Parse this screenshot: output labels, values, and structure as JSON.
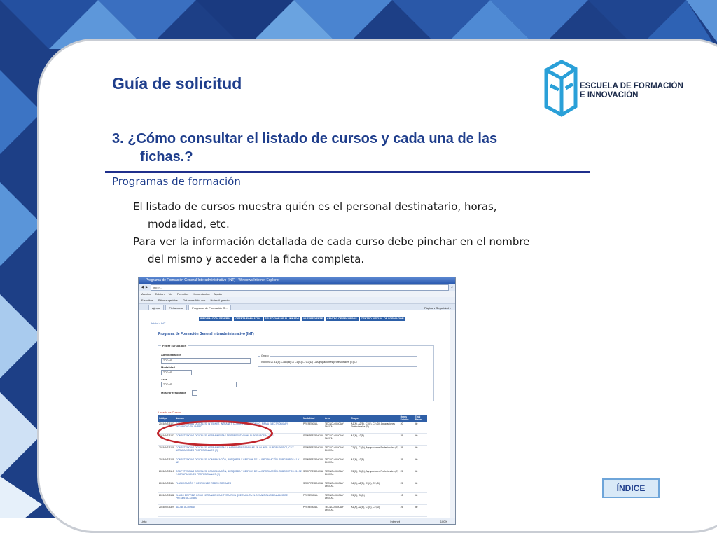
{
  "slide": {
    "title": "Guía de solicitud",
    "logo": {
      "line1": "ESCUELA DE FORMACIÓN",
      "line2": "E INNOVACIÓN"
    },
    "heading": {
      "line1": "3. ¿Cómo consultar el listado de cursos y cada una de las",
      "line2": "fichas.?"
    },
    "subheading": "Programas de formación",
    "paragraph1": {
      "line1": "El listado de cursos muestra quién es el personal destinatario, horas,",
      "line2": "modalidad, etc."
    },
    "paragraph2": {
      "line1": "Para ver la información detallada de cada curso debe pinchar en el nombre",
      "line2": "del mismo y acceder a la ficha completa."
    },
    "index_button": "ÍNDICE"
  },
  "screenshot": {
    "window_title": "Programa de Formación General Interadministrativo (INT) - Windows Internet Explorer",
    "address": "http://...",
    "menu": [
      "Archivo",
      "Edición",
      "Ver",
      "Favoritos",
      "Herramientas",
      "Ayuda"
    ],
    "favorites": [
      "Favoritos",
      "Sitios sugeridos",
      "Get more Add-ons",
      "Hotmail gratuito"
    ],
    "tabs": [
      "Ajenjur",
      "Ficha curso",
      "Programa de Formación G..."
    ],
    "tab_tools": "Página ▾  Seguridad ▾",
    "nav": [
      "INFORMACIÓN GENERAL",
      "OFERTA FORMATIVA",
      "SELECCIÓN DE ALUMNADO",
      "MI EXPEDIENTE",
      "CENTRO DE RECURSOS",
      "CENTRO VIRTUAL DE FORMACIÓN"
    ],
    "breadcrumb": "Inicio > INT",
    "page_title": "Programa de Formación General Interadministrativo (INT)",
    "filter": {
      "legend": "Filtrar cursos por:",
      "admin_label": "Administración",
      "admin_value": "TODAS",
      "mode_label": "Modalidad",
      "mode_value": "TODAS",
      "area_label": "Área",
      "area_value": "TODAS",
      "show_label": "Mostrar resultados",
      "group_label": "Grupo",
      "groups": "TODOS ☑  A1(A) ☐   A2(B) ☐   C1(C) ☐   C2(D) ☐   Agrupaciones profesionales (E) ☐"
    },
    "list_label": "Listado de Cursos",
    "table_headers": [
      "Código",
      "Nombre",
      "Modalidad",
      "Área",
      "Grupos",
      "Horas Edición",
      "Total Plazas"
    ],
    "rows": [
      [
        "2015/INT/3107",
        "COMPETENCIAS DIGITALES: INTERNET, INTRANET, CORREO ELECTRÓNICO, FIRMA ELECTRÓNICA Y SEGURIDAD EN LA RED",
        "PRESENCIAL",
        "TECNOLÓGICA Y DIGITAL",
        "A1(A), A2(B), C1(C), C2 (D), Agrupaciones Profesionales (E)",
        "20",
        "40"
      ],
      [
        "2015/INT/3127",
        "COMPETENCIAS DIGITALES: HERRAMIENTAS DE PRESENTACIÓN. SUBGRUPOS A1 Y A2",
        "SEMIPRESENCIAL",
        "TECNOLÓGICA Y DIGITAL",
        "A1(A), A2(B)",
        "25",
        "40"
      ],
      [
        "2015/INT/3108",
        "COMPETENCIAS DIGITALES: HERRAMIENTAS Y HABILIDADES BÁSICAS EN LA WEB. SUBGRUPOS C1, C2 Y AGRUPACIONES PROFESIONALES (E)",
        "SEMIPRESENCIAL",
        "TECNOLÓGICA Y DIGITAL",
        "C1(C), C2(D), Agrupaciones Profesionales (E)",
        "25",
        "40"
      ],
      [
        "2015/INT/3109",
        "COMPETENCIAS DIGITALES: COMUNICACIÓN, BÚSQUEDA Y GESTIÓN DE LA INFORMACIÓN. SUBGRUPOS A1 Y A2",
        "SEMIPRESENCIAL",
        "TECNOLÓGICA Y DIGITAL",
        "A1(A), A2(B)",
        "25",
        "40"
      ],
      [
        "2015/INT/3110",
        "COMPETENCIAS DIGITALES: COMUNICACIÓN, BÚSQUEDA Y GESTIÓN DE LA INFORMACIÓN. SUBGRUPOS C1, C2 Y AGRUPACIONES PROFESIONALES (E)",
        "SEMIPRESENCIAL",
        "TECNOLÓGICA Y DIGITAL",
        "C1(C), C2(D), Agrupaciones Profesionales (E)",
        "25",
        "40"
      ],
      [
        "2015/INT/3134",
        "PLANIFICACIÓN Y GESTIÓN DE REDES SOCIALES",
        "SEMIPRESENCIAL",
        "TECNOLÓGICA Y DIGITAL",
        "A1(A), A2(B), C1(C), C2 (D)",
        "25",
        "40"
      ],
      [
        "2015/INT/3182",
        "EL USO DE PREZI COMO HERRAMIENTA INTERACTIVA QUE FACILITA EL DESARROLLO DINÁMICO DE PRESENTACIONES",
        "PRESENCIAL",
        "TECNOLÓGICA Y DIGITAL",
        "C1(C), C2(D)",
        "12",
        "40"
      ],
      [
        "2015/INT/3329",
        "ADOBE ACROBAT",
        "PRESENCIAL",
        "TECNOLÓGICA Y DIGITAL",
        "A1(A), A2(B), C1(C), C2 (D)",
        "25",
        "40"
      ]
    ],
    "status_left": "Listo",
    "status_zone": "Internet",
    "status_zoom": "100%"
  },
  "colors": {
    "accent": "#1f3e8c",
    "highlight_oval": "#c0262d",
    "nav_blue": "#2c5fa8"
  }
}
